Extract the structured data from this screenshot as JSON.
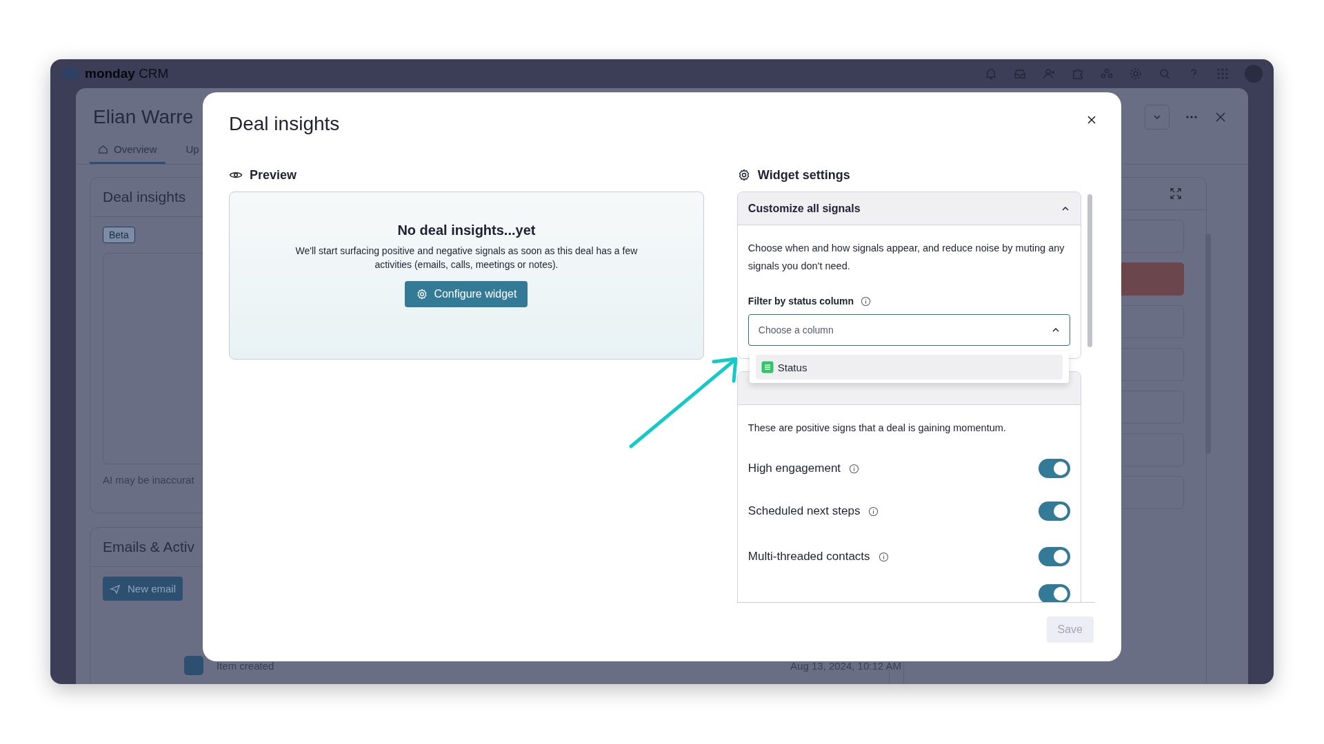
{
  "app_bar": {
    "logo": "monday",
    "product": "CRM"
  },
  "background": {
    "item_title": "Elian Warre",
    "tabs": [
      {
        "label": "Overview",
        "selected": true
      },
      {
        "label": "Up",
        "selected": false
      }
    ],
    "insights_card": {
      "title": "Deal insights",
      "badge": "Beta",
      "note": "AI may be inaccurat"
    },
    "emails_card": {
      "title": "Emails & Activ",
      "button": "New email"
    },
    "activity": {
      "text": "Item created",
      "time": "Aug 13, 2024, 10:12 AM"
    }
  },
  "modal": {
    "title": "Deal insights",
    "preview": {
      "heading": "Preview",
      "empty_title": "No deal insights...yet",
      "empty_text": "We'll start surfacing positive and negative signals as soon as this deal has a few activities (emails, calls, meetings or notes).",
      "button": "Configure widget"
    },
    "settings": {
      "heading": "Widget settings",
      "customize": {
        "title": "Customize all signals",
        "expanded": true,
        "description": "Choose when and how signals appear, and reduce noise by muting any signals you don't need.",
        "filter_label": "Filter by status column",
        "select": {
          "placeholder": "Choose a column",
          "open": true
        },
        "options": [
          {
            "label": "Status",
            "highlighted": true
          }
        ]
      },
      "positive": {
        "description": "These are positive signs that a deal is gaining momentum.",
        "signals": [
          {
            "label": "High engagement",
            "on": true
          },
          {
            "label": "Scheduled next steps",
            "on": true
          },
          {
            "label": "Multi-threaded contacts",
            "on": true
          }
        ],
        "next_toggle": {
          "on": true
        }
      }
    },
    "save": {
      "label": "Save",
      "disabled": true
    }
  }
}
